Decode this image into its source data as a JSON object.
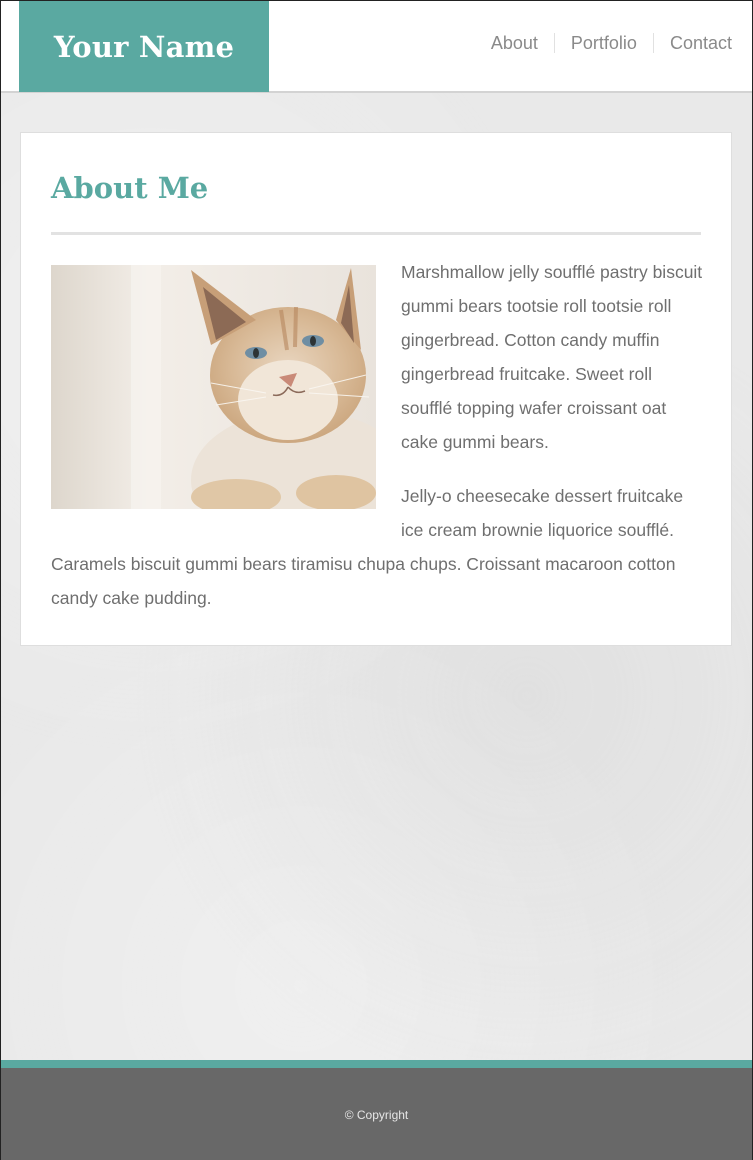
{
  "header": {
    "logo_text": "Your Name",
    "nav": [
      {
        "label": "About"
      },
      {
        "label": "Portfolio"
      },
      {
        "label": "Contact"
      }
    ]
  },
  "main": {
    "title": "About Me",
    "image_icon": "cat-photo",
    "paragraphs": [
      "Marshmallow jelly soufflé pastry biscuit gummi bears tootsie roll tootsie roll gingerbread. Cotton candy muffin gingerbread fruitcake. Sweet roll soufflé topping wafer croissant oat cake gummi bears.",
      "Jelly-o cheesecake dessert fruitcake ice cream brownie liquorice soufflé. Caramels biscuit gummi bears tiramisu chupa chups. Croissant macaroon cotton candy cake pudding."
    ]
  },
  "footer": {
    "copyright": "© Copyright"
  },
  "colors": {
    "accent": "#5aa9a1",
    "footer_bg": "#686868",
    "text": "#6f6f6f",
    "nav_text": "#8a8a8a"
  }
}
